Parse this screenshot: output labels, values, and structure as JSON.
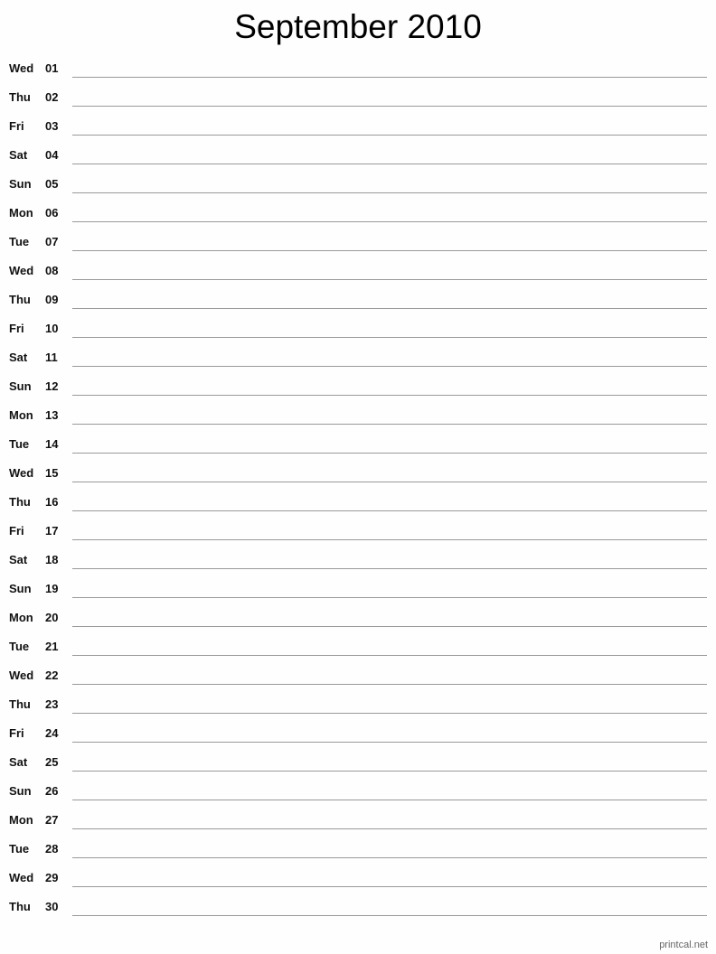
{
  "title": "September 2010",
  "days": [
    {
      "dow": "Wed",
      "num": "01"
    },
    {
      "dow": "Thu",
      "num": "02"
    },
    {
      "dow": "Fri",
      "num": "03"
    },
    {
      "dow": "Sat",
      "num": "04"
    },
    {
      "dow": "Sun",
      "num": "05"
    },
    {
      "dow": "Mon",
      "num": "06"
    },
    {
      "dow": "Tue",
      "num": "07"
    },
    {
      "dow": "Wed",
      "num": "08"
    },
    {
      "dow": "Thu",
      "num": "09"
    },
    {
      "dow": "Fri",
      "num": "10"
    },
    {
      "dow": "Sat",
      "num": "11"
    },
    {
      "dow": "Sun",
      "num": "12"
    },
    {
      "dow": "Mon",
      "num": "13"
    },
    {
      "dow": "Tue",
      "num": "14"
    },
    {
      "dow": "Wed",
      "num": "15"
    },
    {
      "dow": "Thu",
      "num": "16"
    },
    {
      "dow": "Fri",
      "num": "17"
    },
    {
      "dow": "Sat",
      "num": "18"
    },
    {
      "dow": "Sun",
      "num": "19"
    },
    {
      "dow": "Mon",
      "num": "20"
    },
    {
      "dow": "Tue",
      "num": "21"
    },
    {
      "dow": "Wed",
      "num": "22"
    },
    {
      "dow": "Thu",
      "num": "23"
    },
    {
      "dow": "Fri",
      "num": "24"
    },
    {
      "dow": "Sat",
      "num": "25"
    },
    {
      "dow": "Sun",
      "num": "26"
    },
    {
      "dow": "Mon",
      "num": "27"
    },
    {
      "dow": "Tue",
      "num": "28"
    },
    {
      "dow": "Wed",
      "num": "29"
    },
    {
      "dow": "Thu",
      "num": "30"
    }
  ],
  "footer": "printcal.net"
}
